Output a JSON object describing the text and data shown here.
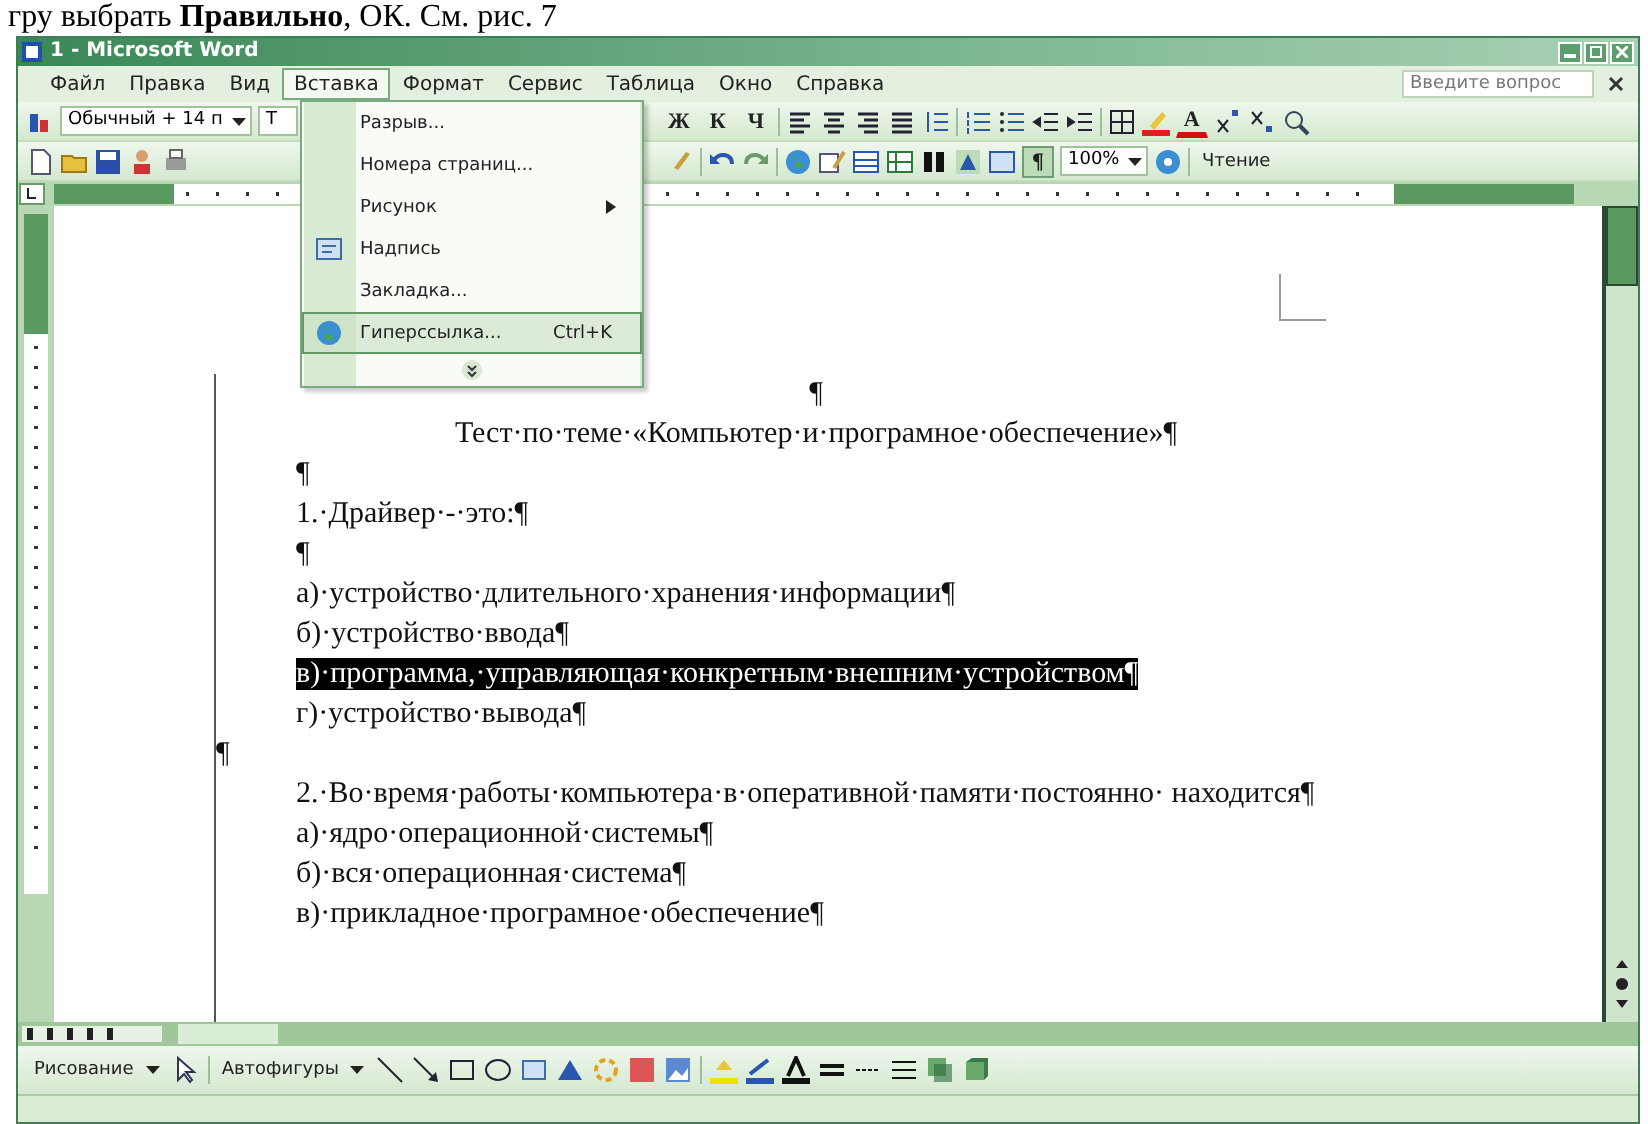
{
  "caption": "гру выбрать **Правильно**, ОК. См. рис. 7",
  "window": {
    "title": "1 - Microsoft Word"
  },
  "menu_bar": {
    "items": [
      {
        "label": "Файл",
        "selected": false
      },
      {
        "label": "Правка",
        "selected": false
      },
      {
        "label": "Вид",
        "selected": false
      },
      {
        "label": "Вставка",
        "selected": true
      },
      {
        "label": "Формат",
        "selected": false
      },
      {
        "label": "Сервис",
        "selected": false
      },
      {
        "label": "Таблица",
        "selected": false
      },
      {
        "label": "Окно",
        "selected": false
      },
      {
        "label": "Справка",
        "selected": false
      }
    ],
    "help_field": {
      "placeholder": "Введите вопрос"
    }
  },
  "insert_menu": [
    {
      "kind": "plain",
      "label": "Разрыв...",
      "selected": false
    },
    {
      "kind": "plain",
      "label": "Номера страниц...",
      "selected": false
    },
    {
      "kind": "submenu",
      "label": "Рисунок",
      "selected": false
    },
    {
      "kind": "textbox",
      "label": "Надпись",
      "selected": false
    },
    {
      "kind": "plain",
      "label": "Закладка...",
      "selected": false
    },
    {
      "kind": "link",
      "label": "Гиперссылка...",
      "shortcut": "Ctrl+K",
      "selected": true
    },
    {
      "kind": "expand",
      "selected": false
    }
  ],
  "formatting_toolbar": {
    "style": "Обычный + 14 п",
    "font": "Т",
    "buttons": [
      "Ж",
      "К",
      "Ч"
    ],
    "font_color": "А"
  },
  "standard_toolbar": {
    "show_marks": {
      "label": "¶",
      "pressed": true
    },
    "zoom": "100%",
    "reading": "Чтение"
  },
  "document": {
    "paragraphs": [
      {
        "kind": "center",
        "text": "¶",
        "selected": false
      },
      {
        "kind": "center",
        "text": "Тест·по·теме·«Компьютер·и·програмное·обеспечение»¶",
        "selected": false
      },
      {
        "kind": "indent",
        "text": "¶",
        "selected": false
      },
      {
        "kind": "indent",
        "text": "1.·Драйвер·-·это:¶",
        "selected": false
      },
      {
        "kind": "indent",
        "text": "¶",
        "selected": false
      },
      {
        "kind": "indent",
        "text": "а)·устройство·длительного·хранения·информации¶",
        "selected": false
      },
      {
        "kind": "indent",
        "text": "б)·устройство·ввода¶",
        "selected": false
      },
      {
        "kind": "indent",
        "text": "в)·программа,·управляющая·конкретным·внешним·устройством¶",
        "selected": true
      },
      {
        "kind": "indent",
        "text": "г)·устройство·вывода¶",
        "selected": false
      },
      {
        "kind": "flush",
        "text": "¶",
        "selected": false
      },
      {
        "kind": "first-line",
        "text": "2.·Во·время·работы·компьютера·в·оперативной·памяти·постоянно· находится¶",
        "selected": false
      },
      {
        "kind": "indent",
        "text": "а)·ядро·операционной·системы¶",
        "selected": false
      },
      {
        "kind": "indent",
        "text": "б)·вся·операционная·система¶",
        "selected": false
      },
      {
        "kind": "indent",
        "text": "в)·прикладное·програмное·обеспечение¶",
        "selected": false
      }
    ]
  },
  "drawing_toolbar": {
    "draw": "Рисование",
    "autoshapes": "Автофигуры"
  }
}
